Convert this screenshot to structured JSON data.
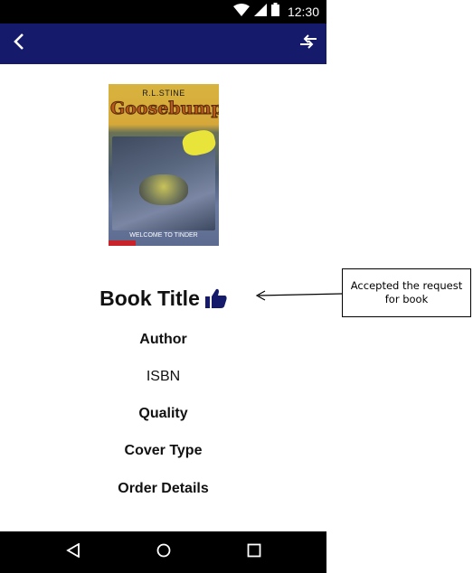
{
  "status_bar": {
    "time": "12:30",
    "icons": [
      "wifi-icon",
      "signal-icon",
      "battery-icon"
    ]
  },
  "app_bar": {
    "back_icon": "chevron-left-icon",
    "action_icon": "swap-icon",
    "color": "#151a6b"
  },
  "cover": {
    "author": "R.L.STINE",
    "series": "Goosebumps",
    "title": "WELCOME TO TINDER"
  },
  "book": {
    "title": "Book Title",
    "status_icon": "thumbs-up-icon",
    "author_label": "Author",
    "isbn_label": "ISBN",
    "quality_label": "Quality",
    "cover_type_label": "Cover Type",
    "order_details_label": "Order Details"
  },
  "nav_bar": {
    "icons": [
      "back-triangle-icon",
      "home-circle-icon",
      "recents-square-icon"
    ]
  },
  "annotation": {
    "text": "Accepted the request for book"
  },
  "colors": {
    "accent": "#151a6b",
    "thumb": "#151a6b"
  }
}
